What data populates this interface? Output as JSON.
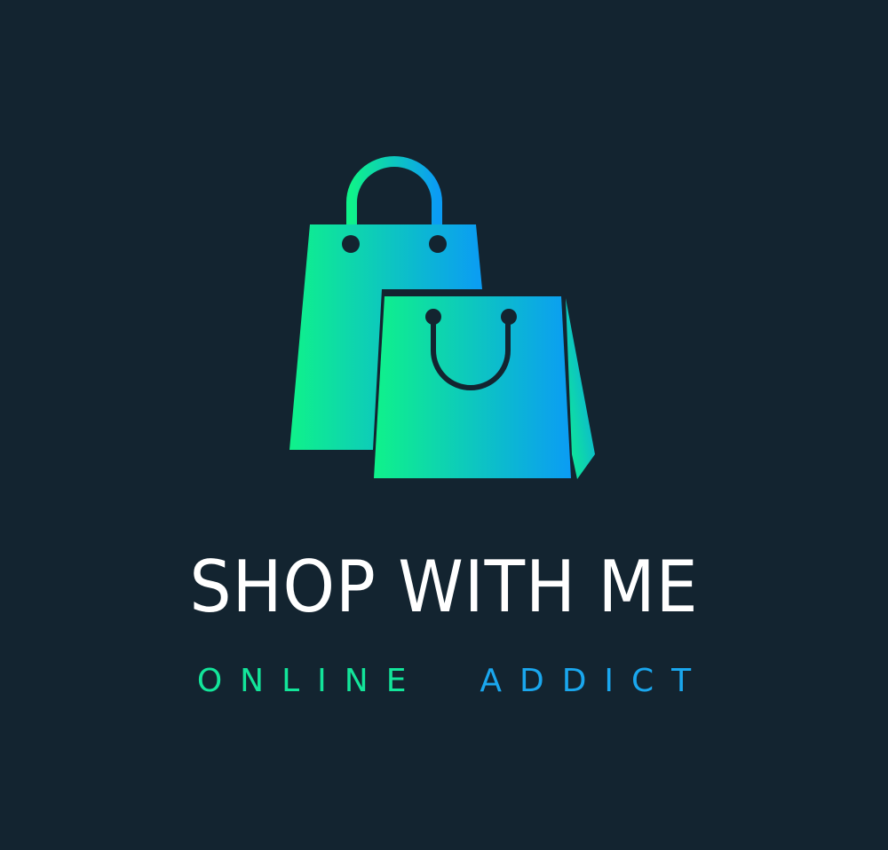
{
  "brand": {
    "title": "SHOP WITH ME",
    "tagline_word_1": "ONLINE",
    "tagline_word_2": "ADDICT"
  },
  "icons": {
    "back_bag": "shopping-bag-icon",
    "front_bag": "shopping-bag-icon"
  },
  "colors": {
    "background": "#132430",
    "gradient_green": "#0ff28a",
    "gradient_blue": "#0b9cf4",
    "title_text": "#ffffff",
    "tagline_green": "#13e59a",
    "tagline_blue": "#1aa7ee"
  }
}
